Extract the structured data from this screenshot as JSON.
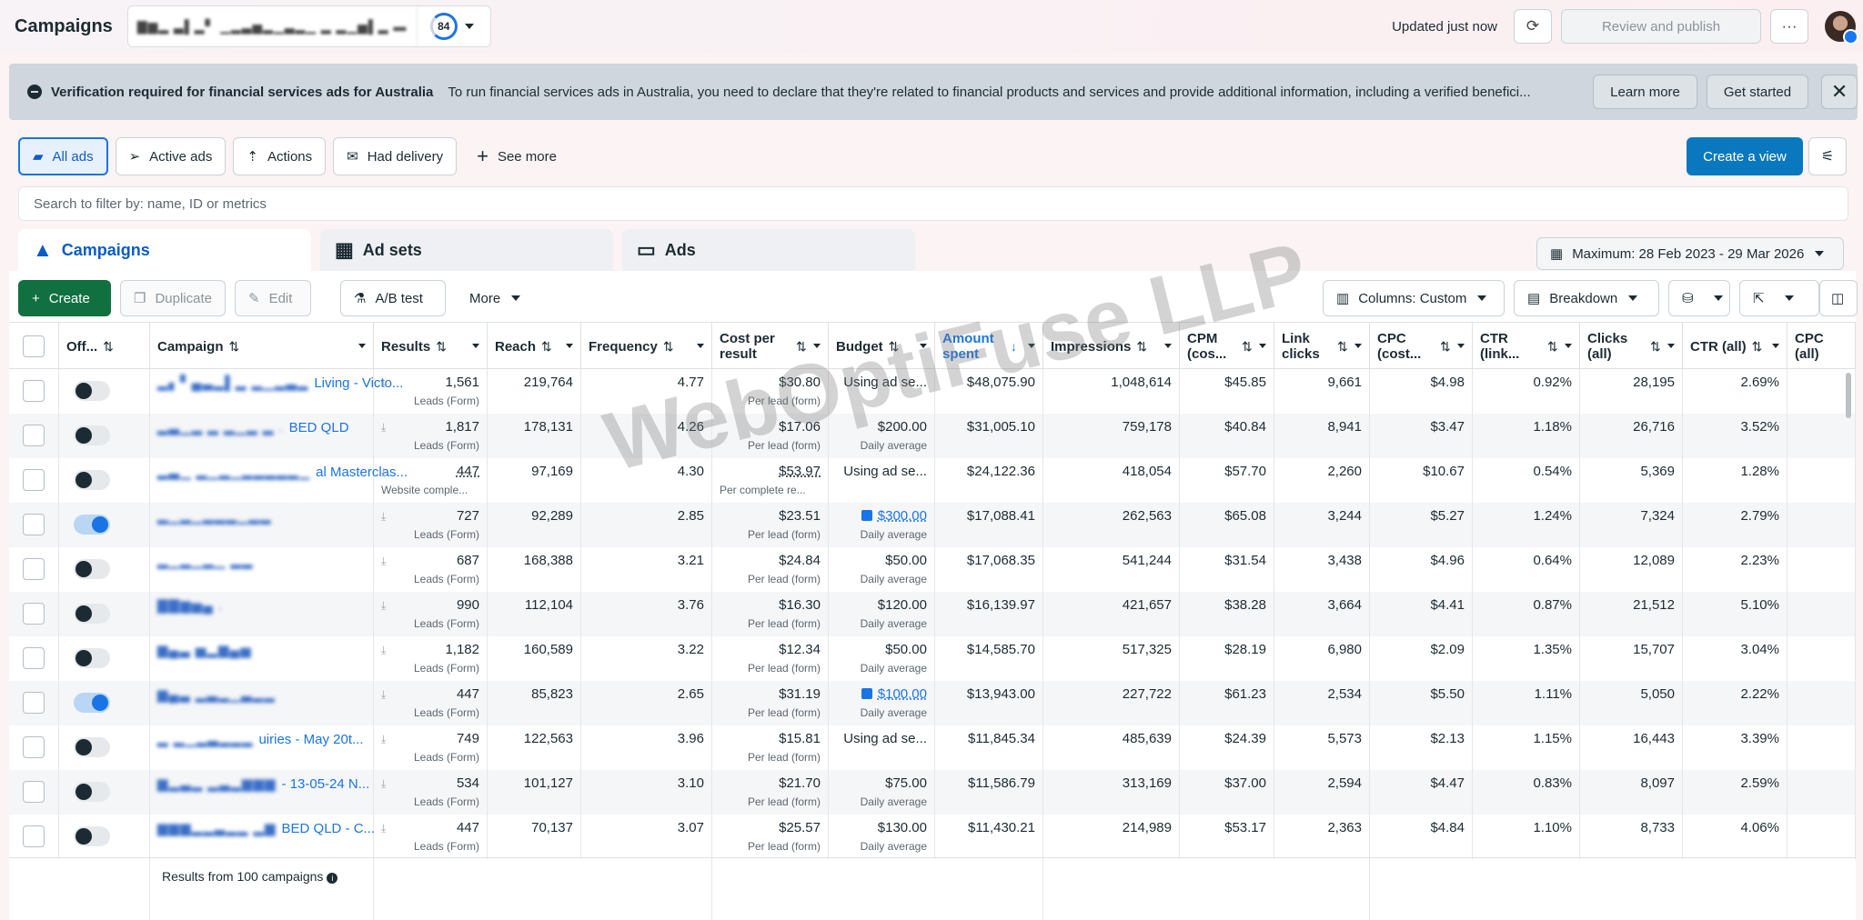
{
  "app": {
    "title": "Campaigns",
    "account_name": "▇▆▂ ▃▌▂▘ ▁▂▃▅▂▁▃▂▁ ▂ ▂▁▅▌▂ ▬",
    "score": "84",
    "updated": "Updated just now",
    "review_publish": "Review and publish",
    "more": "···"
  },
  "banner": {
    "title": "Verification required for financial services ads for Australia",
    "text": "To run financial services ads in Australia, you need to declare that they're related to financial products and services and provide additional information, including a verified benefici...",
    "learn_more": "Learn more",
    "get_started": "Get started",
    "close": "✕"
  },
  "views": {
    "tabs": [
      {
        "label": "All ads",
        "icon": "folder-icon"
      },
      {
        "label": "Active ads",
        "icon": "send-icon"
      },
      {
        "label": "Actions",
        "icon": "upload-arrow-icon"
      },
      {
        "label": "Had delivery",
        "icon": "envelope-icon"
      }
    ],
    "see_more": "See more",
    "create_view": "Create a view"
  },
  "search": {
    "placeholder": "Search to filter by: name, ID or metrics"
  },
  "level_tabs": [
    {
      "label": "Campaigns"
    },
    {
      "label": "Ad sets"
    },
    {
      "label": "Ads"
    }
  ],
  "date_range": "Maximum: 28 Feb 2023 - 29 Mar 2026",
  "toolbar": {
    "create": "Create",
    "duplicate": "Duplicate",
    "edit": "Edit",
    "ab_test": "A/B test",
    "more": "More",
    "columns": "Columns: Custom",
    "breakdown": "Breakdown"
  },
  "columns": [
    {
      "key": "offon",
      "label": "Off..."
    },
    {
      "key": "campaign",
      "label": "Campaign"
    },
    {
      "key": "results",
      "label": "Results"
    },
    {
      "key": "reach",
      "label": "Reach"
    },
    {
      "key": "frequency",
      "label": "Frequency"
    },
    {
      "key": "cpr",
      "label": "Cost per result"
    },
    {
      "key": "budget",
      "label": "Budget"
    },
    {
      "key": "amount",
      "label": "Amount spent"
    },
    {
      "key": "impressions",
      "label": "Impressions"
    },
    {
      "key": "cpm",
      "label": "CPM (cos..."
    },
    {
      "key": "link_clicks",
      "label": "Link clicks"
    },
    {
      "key": "cpc",
      "label": "CPC (cost..."
    },
    {
      "key": "ctr_link",
      "label": "CTR (link..."
    },
    {
      "key": "clicks_all",
      "label": "Clicks (all)"
    },
    {
      "key": "ctr_all",
      "label": "CTR (all)"
    },
    {
      "key": "cpc_all",
      "label": "CPC (all)"
    }
  ],
  "rows": [
    {
      "on": false,
      "name_blur": "▂▖▘▄▃▂▌▂ ▂▁▂▃▂",
      "name_text": "Living - Victo...",
      "results": "1,561",
      "results_sub": "Leads (Form)",
      "reach": "219,764",
      "frequency": "4.77",
      "cpr": "$30.80",
      "cpr_sub": "Per lead (form)",
      "budget": "Using ad se...",
      "budget_sub": "",
      "amount": "$48,075.90",
      "impressions": "1,048,614",
      "cpm": "$45.85",
      "link_clicks": "9,661",
      "cpc": "$4.98",
      "ctr_link": "0.92%",
      "clicks_all": "28,195",
      "ctr_all": "2.69%"
    },
    {
      "on": false,
      "name_blur": "▂▃▁▂ ▂ ▂▁▂ ▂ .",
      "name_text": "BED QLD",
      "results": "1,817",
      "results_sub": "Leads (Form)",
      "reach": "178,131",
      "frequency": "4.26",
      "cpr": "$17.06",
      "cpr_sub": "Per lead (form)",
      "budget": "$200.00",
      "budget_sub": "Daily average",
      "amount": "$31,005.10",
      "impressions": "759,178",
      "cpm": "$40.84",
      "link_clicks": "8,941",
      "cpc": "$3.47",
      "ctr_link": "1.18%",
      "clicks_all": "26,716",
      "ctr_all": "3.52%"
    },
    {
      "on": false,
      "name_blur": "▂▃▁ ▂▁▂▁▂▂▂▂▂▁",
      "name_text": "al Masterclas...",
      "results": "447",
      "results_sub": "Website comple...",
      "reach": "97,169",
      "frequency": "4.30",
      "cpr": "$53.97",
      "cpr_sub": "Per complete re...",
      "budget": "Using ad se...",
      "budget_sub": "",
      "amount": "$24,122.36",
      "impressions": "418,054",
      "cpm": "$57.70",
      "link_clicks": "2,260",
      "cpc": "$10.67",
      "ctr_link": "0.54%",
      "clicks_all": "5,369",
      "ctr_all": "1.28%"
    },
    {
      "on": true,
      "name_blur": "▂▁▂▁▂▂▂▁▂▂",
      "name_text": "",
      "results": "727",
      "results_sub": "Leads (Form)",
      "reach": "92,289",
      "frequency": "2.85",
      "cpr": "$23.51",
      "cpr_sub": "Per lead (form)",
      "budget": "$300.00",
      "budget_sub": "Daily average",
      "amount": "$17,088.41",
      "impressions": "262,563",
      "cpm": "$65.08",
      "link_clicks": "3,244",
      "cpc": "$5.27",
      "ctr_link": "1.24%",
      "clicks_all": "7,324",
      "ctr_all": "2.79%"
    },
    {
      "on": false,
      "name_blur": "▂▁▂▁▂▁ ▂▂",
      "name_text": "",
      "results": "687",
      "results_sub": "Leads (Form)",
      "reach": "168,388",
      "frequency": "3.21",
      "cpr": "$24.84",
      "cpr_sub": "Per lead (form)",
      "budget": "$50.00",
      "budget_sub": "Daily average",
      "amount": "$17,068.35",
      "impressions": "541,244",
      "cpm": "$31.54",
      "link_clicks": "3,438",
      "cpc": "$4.96",
      "ctr_link": "0.64%",
      "clicks_all": "12,089",
      "ctr_all": "2.23%"
    },
    {
      "on": false,
      "name_blur": "▇▇▆▅▄ .",
      "name_text": "",
      "results": "990",
      "results_sub": "Leads (Form)",
      "reach": "112,104",
      "frequency": "3.76",
      "cpr": "$16.30",
      "cpr_sub": "Per lead (form)",
      "budget": "$120.00",
      "budget_sub": "Daily average",
      "amount": "$16,139.97",
      "impressions": "421,657",
      "cpm": "$38.28",
      "link_clicks": "3,664",
      "cpc": "$4.41",
      "ctr_link": "0.87%",
      "clicks_all": "21,512",
      "ctr_all": "5.10%"
    },
    {
      "on": false,
      "name_blur": "▆▄▃ ▅▂▆▄▅",
      "name_text": "",
      "results": "1,182",
      "results_sub": "Leads (Form)",
      "reach": "160,589",
      "frequency": "3.22",
      "cpr": "$12.34",
      "cpr_sub": "Per lead (form)",
      "budget": "$50.00",
      "budget_sub": "Daily average",
      "amount": "$14,585.70",
      "impressions": "517,325",
      "cpm": "$28.19",
      "link_clicks": "6,980",
      "cpc": "$2.09",
      "ctr_link": "1.35%",
      "clicks_all": "15,707",
      "ctr_all": "3.04%"
    },
    {
      "on": true,
      "name_blur": "▆▄▃ ▂▃▂▁▃▂▂",
      "name_text": "",
      "results": "447",
      "results_sub": "Leads (Form)",
      "reach": "85,823",
      "frequency": "2.65",
      "cpr": "$31.19",
      "cpr_sub": "Per lead (form)",
      "budget": "$100.00",
      "budget_sub": "Daily average",
      "amount": "$13,943.00",
      "impressions": "227,722",
      "cpm": "$61.23",
      "link_clicks": "2,534",
      "cpc": "$5.50",
      "ctr_link": "1.11%",
      "clicks_all": "5,050",
      "ctr_all": "2.22%"
    },
    {
      "on": false,
      "name_blur": "▂ ▂▁▂▃▂▂▂",
      "name_text": "uiries - May 20t...",
      "results": "749",
      "results_sub": "Leads (Form)",
      "reach": "122,563",
      "frequency": "3.96",
      "cpr": "$15.81",
      "cpr_sub": "Per lead (form)",
      "budget": "Using ad se...",
      "budget_sub": "",
      "amount": "$11,845.34",
      "impressions": "485,639",
      "cpm": "$24.39",
      "link_clicks": "5,573",
      "cpc": "$2.13",
      "ctr_link": "1.15%",
      "clicks_all": "16,443",
      "ctr_all": "3.39%"
    },
    {
      "on": false,
      "name_blur": "▆▂▃▂ ▂▃▂▆▆▆",
      "name_text": "- 13-05-24 N...",
      "results": "534",
      "results_sub": "Leads (Form)",
      "reach": "101,127",
      "frequency": "3.10",
      "cpr": "$21.70",
      "cpr_sub": "Per lead (form)",
      "budget": "$75.00",
      "budget_sub": "Daily average",
      "amount": "$11,586.79",
      "impressions": "313,169",
      "cpm": "$37.00",
      "link_clicks": "2,594",
      "cpc": "$4.47",
      "ctr_link": "0.83%",
      "clicks_all": "8,097",
      "ctr_all": "2.59%"
    },
    {
      "on": false,
      "name_blur": "▆▆▆▂▂▃▂▂ ▂▆",
      "name_text": "BED QLD - C...",
      "results": "447",
      "results_sub": "Leads (Form)",
      "reach": "70,137",
      "frequency": "3.07",
      "cpr": "$25.57",
      "cpr_sub": "Per lead (form)",
      "budget": "$130.00",
      "budget_sub": "Daily average",
      "amount": "$11,430.21",
      "impressions": "214,989",
      "cpm": "$53.17",
      "link_clicks": "2,363",
      "cpc": "$4.84",
      "ctr_link": "1.10%",
      "clicks_all": "8,733",
      "ctr_all": "4.06%"
    }
  ],
  "footer": {
    "text": "Results from 100 campaigns",
    "info": "i"
  },
  "watermark": "WebOptiFuse LLP"
}
